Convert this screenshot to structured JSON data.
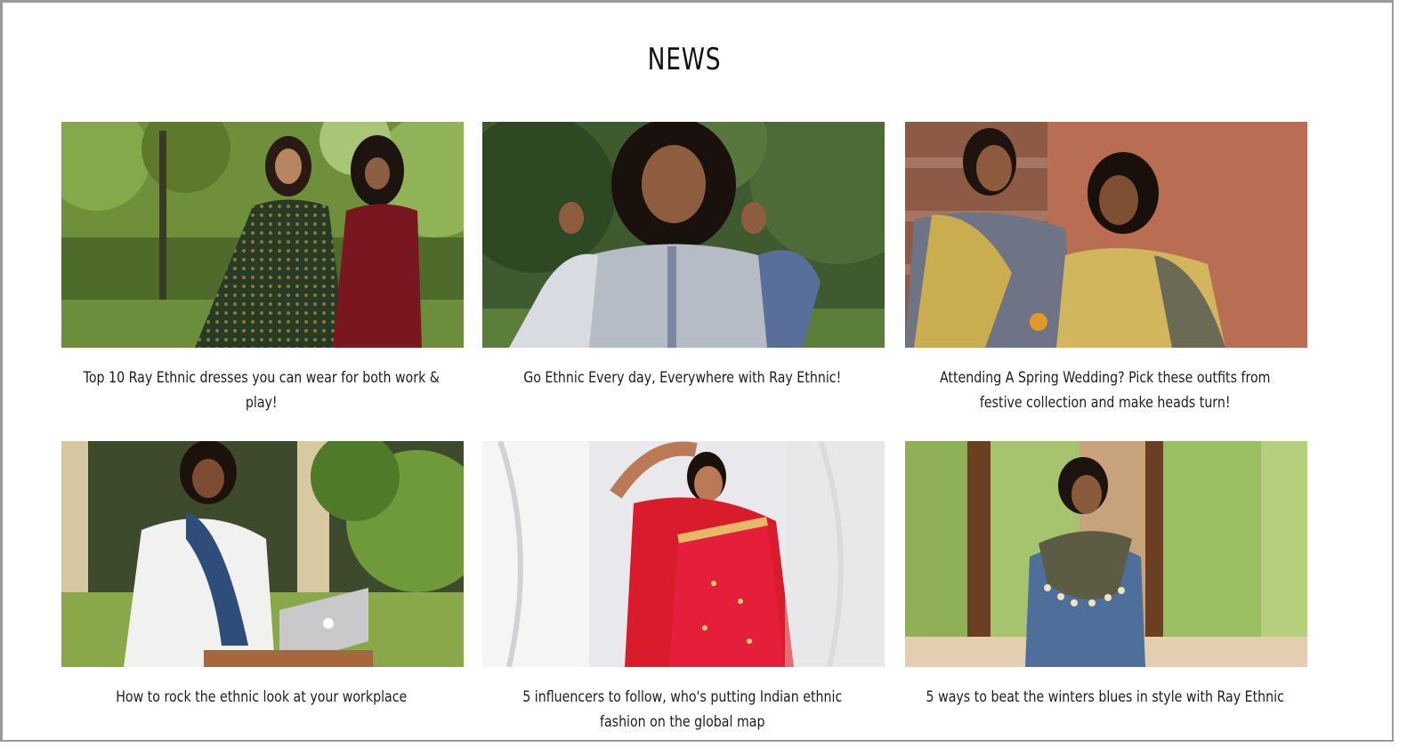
{
  "section": {
    "title": "NEWS"
  },
  "articles": [
    {
      "caption": "Top 10 Ray Ethnic dresses you can wear for both work & play!",
      "image": "two-women-garden-dresses"
    },
    {
      "caption": "Go Ethnic Every day, Everywhere with Ray Ethnic!",
      "image": "woman-grey-kurta-forest"
    },
    {
      "caption": "Attending A Spring Wedding? Pick these outfits from festive collection and make heads turn!",
      "image": "two-women-festive-steps"
    },
    {
      "caption": "How to rock the ethnic look at your workplace",
      "image": "woman-laptop-workplace"
    },
    {
      "caption": "5 influencers to follow, who's putting Indian ethnic fashion on the global map",
      "image": "woman-red-saree-curtains"
    },
    {
      "caption": "5 ways to beat the winters blues in style with Ray Ethnic",
      "image": "woman-scarf-window"
    }
  ],
  "colors": {
    "border": "#9a9a9a",
    "text": "#1d1d1d",
    "background": "#ffffff"
  }
}
